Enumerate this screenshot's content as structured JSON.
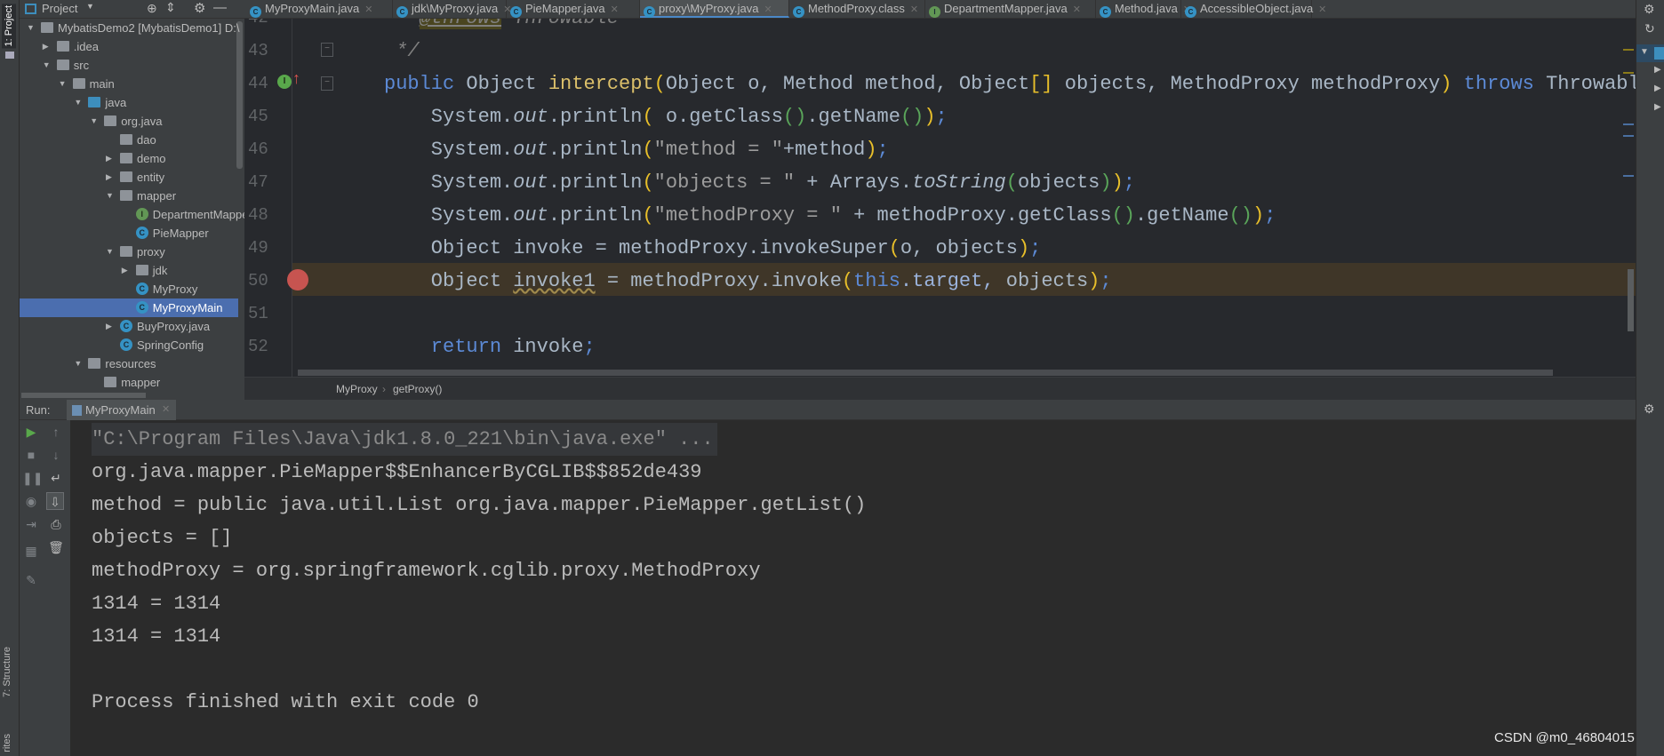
{
  "left_strip": {
    "project_label": "1: Project",
    "structure_label": "7: Structure",
    "favorites_label": "rites"
  },
  "project_panel": {
    "title": "Project",
    "tree": [
      {
        "label": "MybatisDemo2 [MybatisDemo1] D:\\",
        "level": 0,
        "arrow": "down",
        "icon": "project"
      },
      {
        "label": ".idea",
        "level": 1,
        "arrow": "right",
        "icon": "folder"
      },
      {
        "label": "src",
        "level": 1,
        "arrow": "down",
        "icon": "folder"
      },
      {
        "label": "main",
        "level": 2,
        "arrow": "down",
        "icon": "folder"
      },
      {
        "label": "java",
        "level": 3,
        "arrow": "down",
        "icon": "src"
      },
      {
        "label": "org.java",
        "level": 4,
        "arrow": "down",
        "icon": "pkg"
      },
      {
        "label": "dao",
        "level": 5,
        "arrow": "",
        "icon": "pkg"
      },
      {
        "label": "demo",
        "level": 5,
        "arrow": "right",
        "icon": "pkg"
      },
      {
        "label": "entity",
        "level": 5,
        "arrow": "right",
        "icon": "pkg"
      },
      {
        "label": "mapper",
        "level": 5,
        "arrow": "down",
        "icon": "pkg"
      },
      {
        "label": "DepartmentMapper",
        "level": 6,
        "arrow": "",
        "icon": "intf"
      },
      {
        "label": "PieMapper",
        "level": 6,
        "arrow": "",
        "icon": "cls"
      },
      {
        "label": "proxy",
        "level": 5,
        "arrow": "down",
        "icon": "pkg"
      },
      {
        "label": "jdk",
        "level": 6,
        "arrow": "right",
        "icon": "pkg"
      },
      {
        "label": "MyProxy",
        "level": 6,
        "arrow": "",
        "icon": "cls"
      },
      {
        "label": "MyProxyMain",
        "level": 6,
        "arrow": "",
        "icon": "cls",
        "selected": true
      },
      {
        "label": "BuyProxy.java",
        "level": 5,
        "arrow": "right",
        "icon": "cls"
      },
      {
        "label": "SpringConfig",
        "level": 5,
        "arrow": "",
        "icon": "cls"
      },
      {
        "label": "resources",
        "level": 3,
        "arrow": "down",
        "icon": "folder"
      },
      {
        "label": "mapper",
        "level": 4,
        "arrow": "",
        "icon": "pkg"
      }
    ]
  },
  "tabs": [
    {
      "label": "MyProxyMain.java",
      "icon": "C"
    },
    {
      "label": "jdk\\MyProxy.java",
      "icon": "C"
    },
    {
      "label": "PieMapper.java",
      "icon": "C"
    },
    {
      "label": "proxy\\MyProxy.java",
      "icon": "C",
      "active": true
    },
    {
      "label": "MethodProxy.class",
      "icon": "C"
    },
    {
      "label": "DepartmentMapper.java",
      "icon": "I"
    },
    {
      "label": "Method.java",
      "icon": "C"
    },
    {
      "label": "AccessibleObject.java",
      "icon": "C"
    }
  ],
  "editor": {
    "lines": [
      {
        "num": "42",
        "tokens": [
          {
            "t": " * ",
            "c": "cm"
          },
          {
            "t": "@throws",
            "c": "tag"
          },
          {
            "t": " Throwable",
            "c": "cm"
          }
        ]
      },
      {
        "num": "43",
        "tokens": [
          {
            "t": " */",
            "c": "cm"
          }
        ]
      },
      {
        "num": "44",
        "tokens": [
          {
            "t": "public ",
            "c": "kw"
          },
          {
            "t": "Object "
          },
          {
            "t": "intercept",
            "c": "fn"
          },
          {
            "t": "(",
            "c": "b1"
          },
          {
            "t": "Object o, Method method, Object"
          },
          {
            "t": "[]",
            "c": "b1"
          },
          {
            "t": " objects, MethodProxy methodProxy"
          },
          {
            "t": ")",
            "c": "b1"
          },
          {
            "t": " throws ",
            "c": "kw"
          },
          {
            "t": "Throwable {"
          }
        ]
      },
      {
        "num": "45",
        "tokens": [
          {
            "t": "    System."
          },
          {
            "t": "out",
            "c": "it"
          },
          {
            "t": ".println"
          },
          {
            "t": "(",
            "c": "b1"
          },
          {
            "t": " o.getClass"
          },
          {
            "t": "()",
            "c": "b2"
          },
          {
            "t": ".getName"
          },
          {
            "t": "()",
            "c": "b2"
          },
          {
            "t": ")",
            "c": "b1"
          },
          {
            "t": ";",
            "c": "kw"
          }
        ]
      },
      {
        "num": "46",
        "tokens": [
          {
            "t": "    System."
          },
          {
            "t": "out",
            "c": "it"
          },
          {
            "t": ".println"
          },
          {
            "t": "(",
            "c": "b1"
          },
          {
            "t": "\"method = \"",
            "c": "str"
          },
          {
            "t": "+method"
          },
          {
            "t": ")",
            "c": "b1"
          },
          {
            "t": ";",
            "c": "kw"
          }
        ]
      },
      {
        "num": "47",
        "tokens": [
          {
            "t": "    System."
          },
          {
            "t": "out",
            "c": "it"
          },
          {
            "t": ".println"
          },
          {
            "t": "(",
            "c": "b1"
          },
          {
            "t": "\"objects = \"",
            "c": "str"
          },
          {
            "t": " + Arrays."
          },
          {
            "t": "toString",
            "c": "it"
          },
          {
            "t": "(",
            "c": "b2"
          },
          {
            "t": "objects"
          },
          {
            "t": ")",
            "c": "b2"
          },
          {
            "t": ")",
            "c": "b1"
          },
          {
            "t": ";",
            "c": "kw"
          }
        ]
      },
      {
        "num": "48",
        "tokens": [
          {
            "t": "    System."
          },
          {
            "t": "out",
            "c": "it"
          },
          {
            "t": ".println"
          },
          {
            "t": "(",
            "c": "b1"
          },
          {
            "t": "\"methodProxy = \"",
            "c": "str"
          },
          {
            "t": " + methodProxy.getClass"
          },
          {
            "t": "()",
            "c": "b2"
          },
          {
            "t": ".getName"
          },
          {
            "t": "()",
            "c": "b2"
          },
          {
            "t": ")",
            "c": "b1"
          },
          {
            "t": ";",
            "c": "kw"
          }
        ]
      },
      {
        "num": "49",
        "tokens": [
          {
            "t": "    Object invoke = methodProxy.invokeSuper"
          },
          {
            "t": "(",
            "c": "b1"
          },
          {
            "t": "o, objects"
          },
          {
            "t": ")",
            "c": "b1"
          },
          {
            "t": ";",
            "c": "kw"
          }
        ]
      },
      {
        "num": "50",
        "breakpoint": true,
        "tokens": [
          {
            "t": "    Object "
          },
          {
            "t": "invoke1",
            "c": "warn"
          },
          {
            "t": " = methodProxy.invoke"
          },
          {
            "t": "(",
            "c": "b1"
          },
          {
            "t": "this",
            "c": "kw"
          },
          {
            "t": ".target, ",
            "c": "fld"
          },
          {
            "t": "objects"
          },
          {
            "t": ")",
            "c": "b1"
          },
          {
            "t": ";",
            "c": "kw"
          }
        ]
      },
      {
        "num": "51",
        "tokens": []
      },
      {
        "num": "52",
        "tokens": [
          {
            "t": "    return ",
            "c": "kw"
          },
          {
            "t": "invoke"
          },
          {
            "t": ";",
            "c": "kw"
          }
        ]
      }
    ]
  },
  "breadcrumb": {
    "items": [
      "MyProxy",
      "getProxy()"
    ],
    "separator": "›"
  },
  "run": {
    "label": "Run:",
    "tab": "MyProxyMain",
    "console": [
      "\"C:\\Program Files\\Java\\jdk1.8.0_221\\bin\\java.exe\" ...",
      "org.java.mapper.PieMapper$$EnhancerByCGLIB$$852de439",
      "method = public java.util.List org.java.mapper.PieMapper.getList()",
      "objects = []",
      "methodProxy = org.springframework.cglib.proxy.MethodProxy",
      "1314 = 1314",
      "1314 = 1314",
      "",
      "Process finished with exit code 0"
    ]
  },
  "watermark": "CSDN @m0_46804015",
  "colors": {
    "selection": "#4b6eaf",
    "current_line": "#3f3628",
    "breakpoint": "#c75450",
    "keyword": "#5c8ad6"
  }
}
